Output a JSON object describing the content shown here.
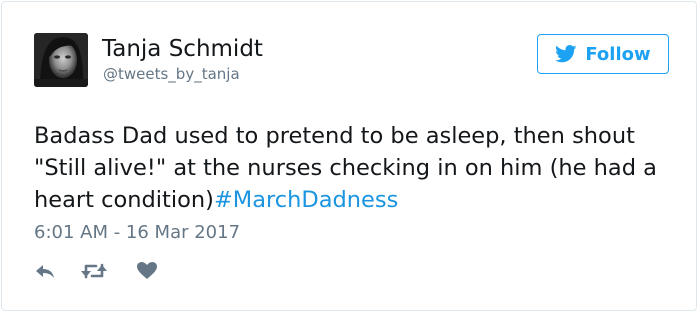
{
  "tweet": {
    "author": {
      "display_name": "Tanja Schmidt",
      "username": "@tweets_by_tanja",
      "avatar_icon": "profile-photo"
    },
    "follow_button": {
      "label": "Follow",
      "icon": "twitter-bird-icon"
    },
    "text": {
      "body": "Badass Dad used to pretend to be asleep, then shout \"Still alive!\" at the nurses checking in on him (he had a heart condition)",
      "hashtag": "#MarchDadness"
    },
    "timestamp": "6:01 AM - 16 Mar 2017",
    "actions": [
      {
        "name": "reply",
        "icon": "reply-icon"
      },
      {
        "name": "retweet",
        "icon": "retweet-icon"
      },
      {
        "name": "like",
        "icon": "heart-icon"
      }
    ]
  },
  "colors": {
    "accent": "#1da1f2",
    "hashtag": "#1b95e0",
    "text": "#14171a",
    "secondary_text": "#657786",
    "action_icon": "#657786",
    "border": "#e1e8ed"
  }
}
